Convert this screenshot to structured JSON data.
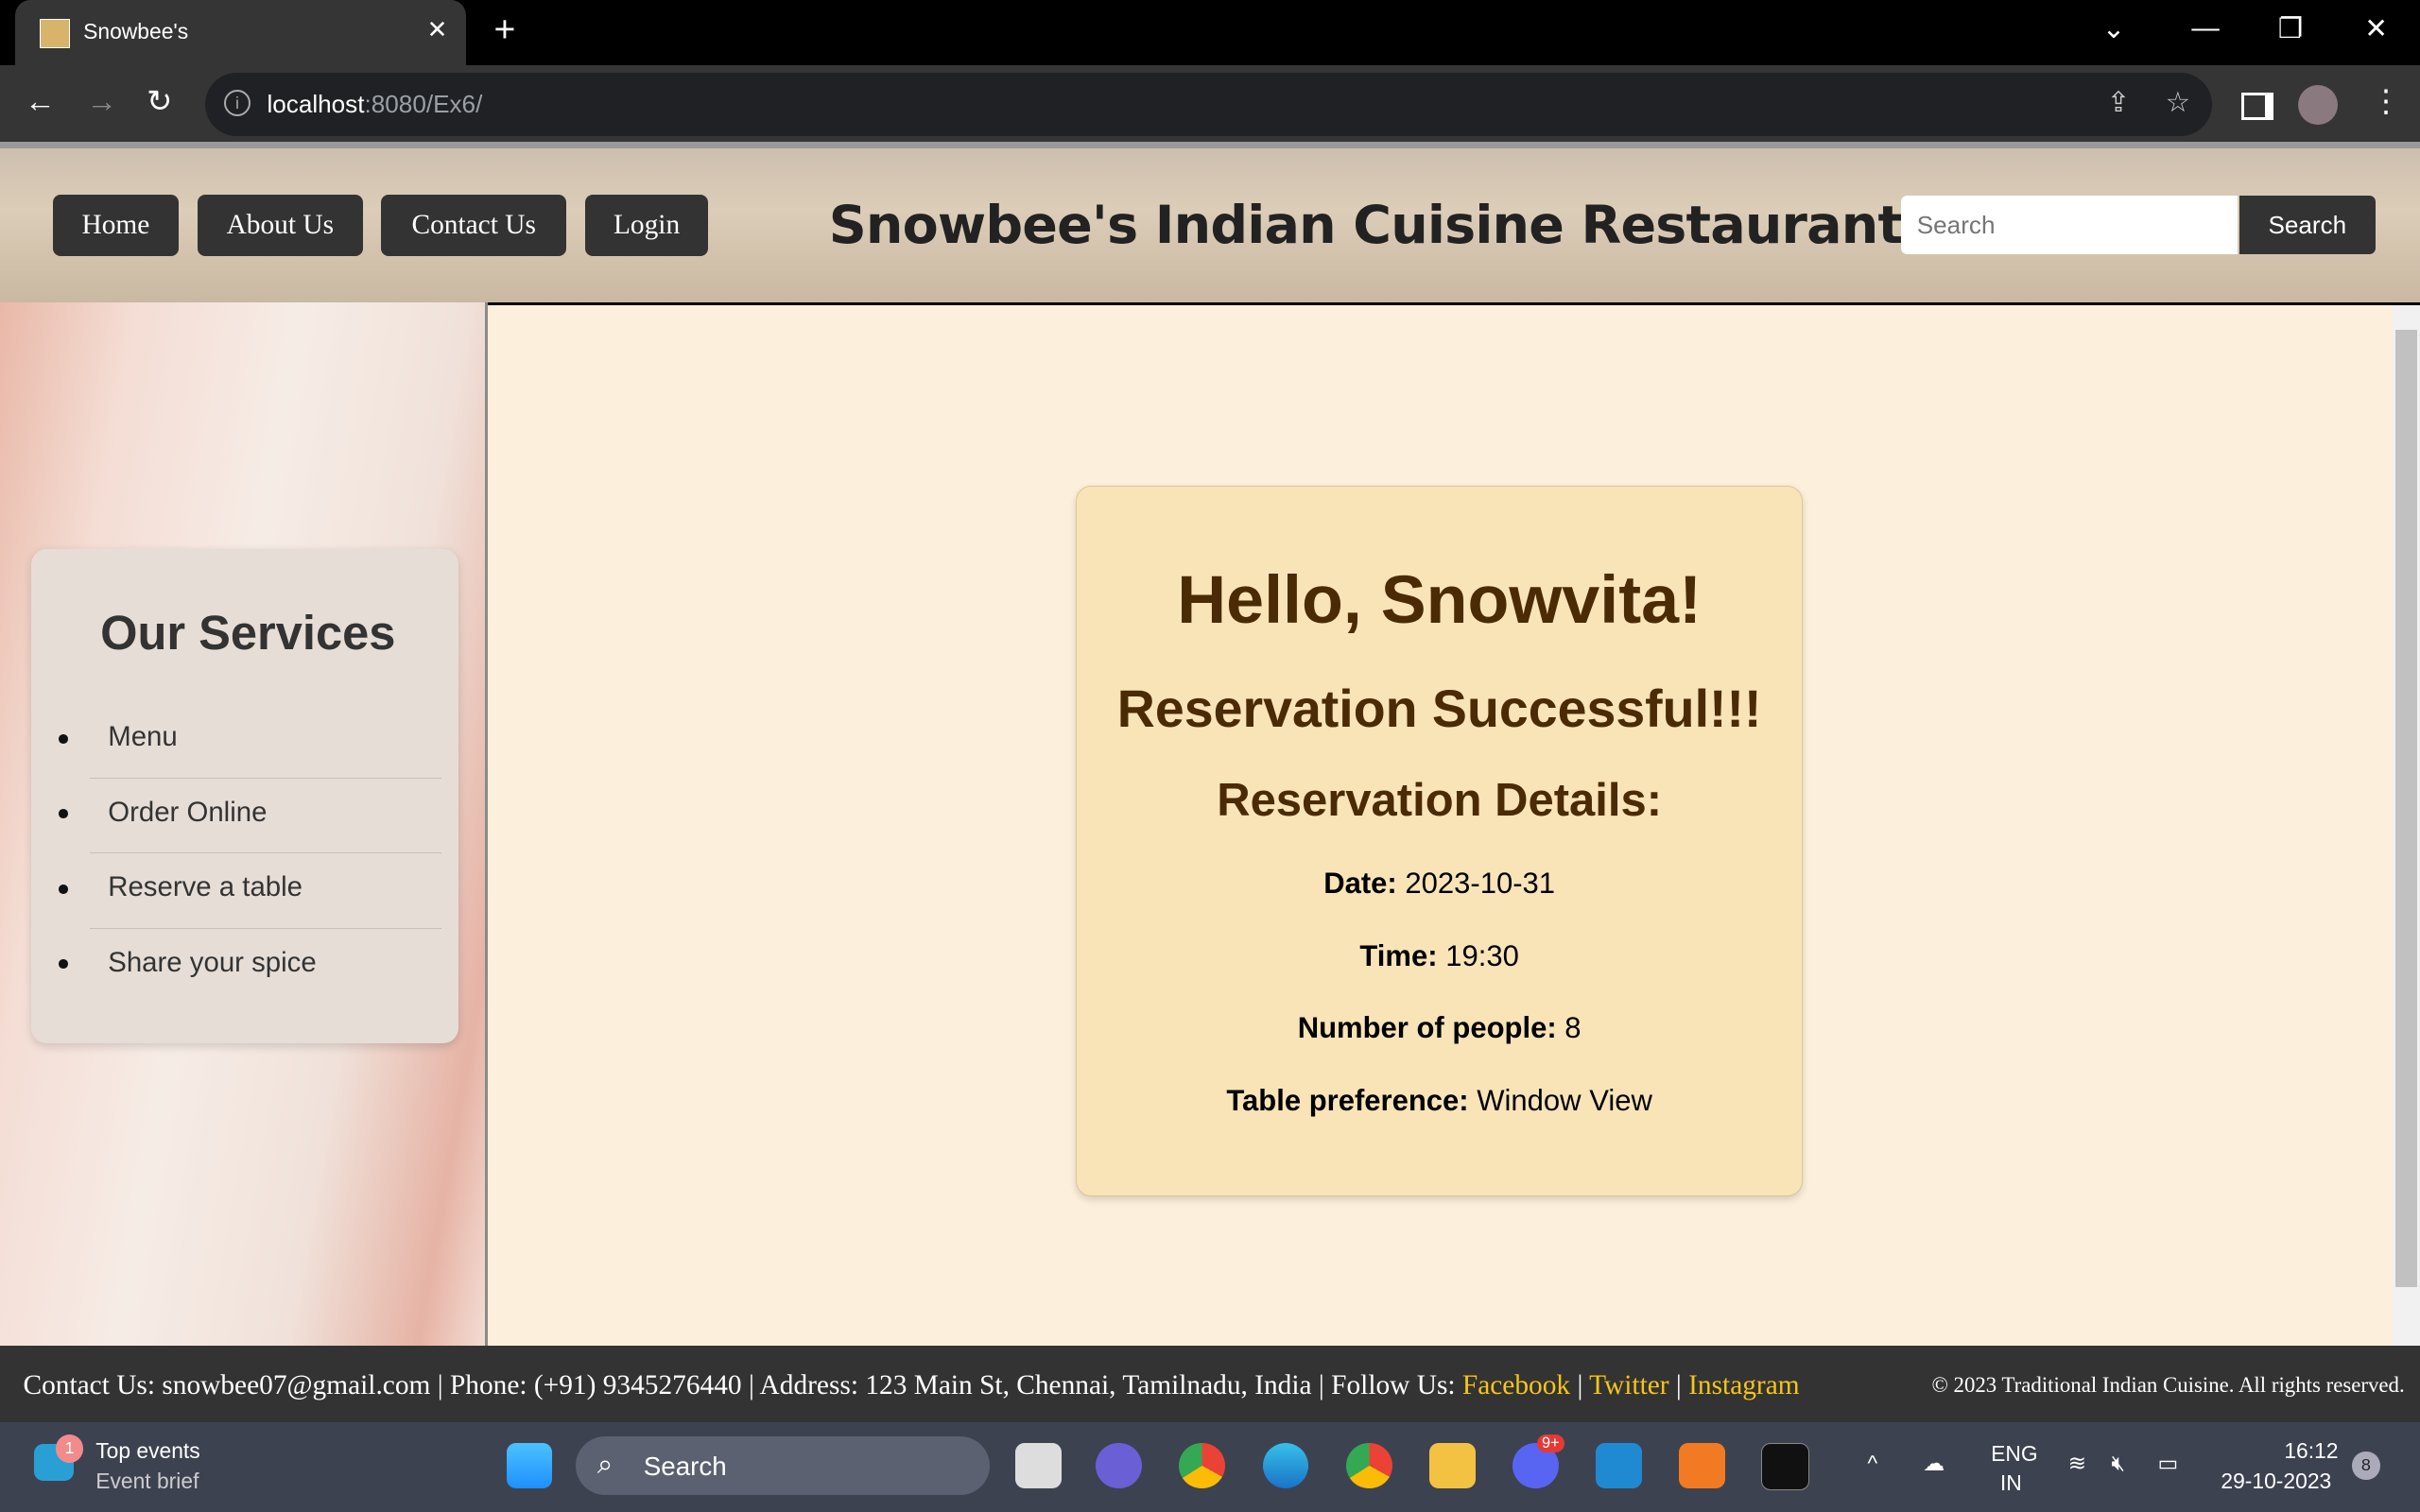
{
  "browser": {
    "tab_title": "Snowbee's",
    "url_host": "localhost",
    "url_path": ":8080/Ex6/"
  },
  "nav": {
    "home": "Home",
    "about": "About Us",
    "contact": "Contact Us",
    "login": "Login"
  },
  "site_title": "Snowbee's Indian Cuisine Restaurant",
  "search": {
    "placeholder": "Search",
    "button": "Search"
  },
  "sidebar": {
    "heading": "Our Services",
    "items": [
      "Menu",
      "Order Online",
      "Reserve a table",
      "Share your spice"
    ]
  },
  "card": {
    "greeting": "Hello, Snowvita!",
    "status": "Reservation Successful!!!",
    "details_heading": "Reservation Details:",
    "details": [
      {
        "label": "Date:",
        "value": "2023-10-31"
      },
      {
        "label": "Time:",
        "value": "19:30"
      },
      {
        "label": "Number of people:",
        "value": "8"
      },
      {
        "label": "Table preference:",
        "value": "Window View"
      }
    ]
  },
  "footer": {
    "contact": "Contact Us: snowbee07@gmail.com | Phone: (+91) 9345276440 | Address: 123 Main St, Chennai, Tamilnadu, India | Follow Us: ",
    "facebook": "Facebook",
    "twitter": "Twitter",
    "instagram": "Instagram",
    "sep": " | ",
    "copyright": "© 2023 Traditional Indian Cuisine. All rights reserved."
  },
  "taskbar": {
    "widget_title": "Top events",
    "widget_sub": "Event brief",
    "widget_badge": "1",
    "search": "Search",
    "lang": "ENG",
    "region": "IN",
    "time": "16:12",
    "date": "29-10-2023",
    "notif": "8",
    "discord_badge": "9+"
  },
  "colors": {
    "footer_link": "#f5c518",
    "card_bg": "#f9e4b8",
    "page_bg": "#fcf0dc"
  }
}
